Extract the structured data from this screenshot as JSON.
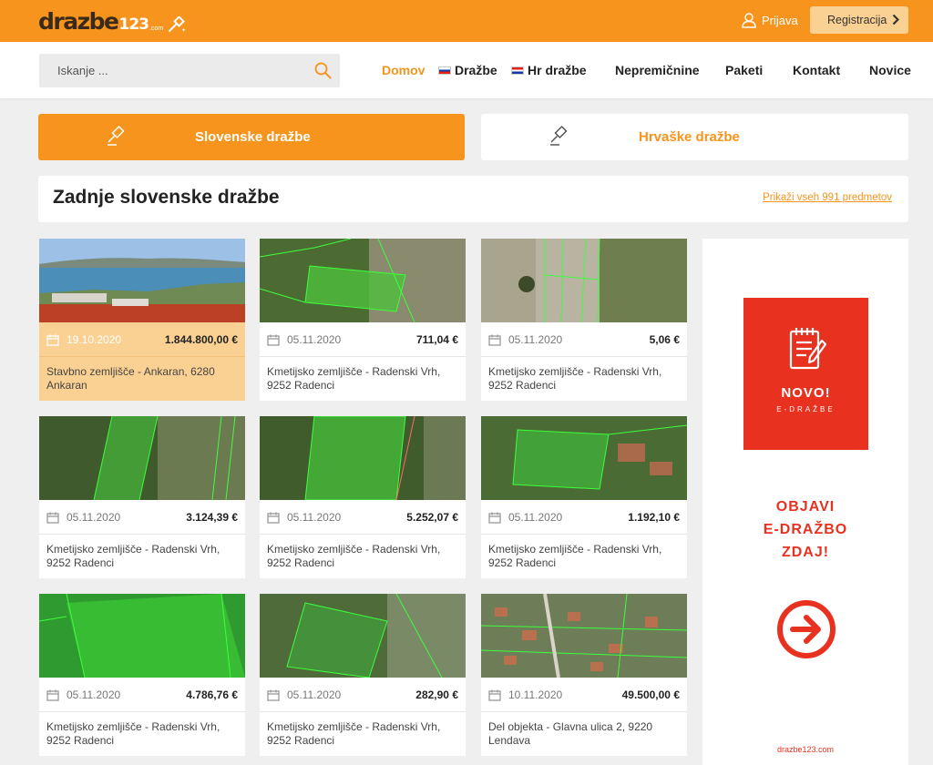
{
  "header": {
    "logo_text": "drazbe",
    "logo_num": "123",
    "logo_com": ".com",
    "login_label": "Prijava",
    "register_label": "Registracija"
  },
  "search": {
    "placeholder": "Iskanje ...",
    "value": ""
  },
  "nav": {
    "home": "Domov",
    "auctions": "Dražbe",
    "hr_auctions": "Hr dražbe",
    "real_estate": "Nepremičnine",
    "packages": "Paketi",
    "contact": "Kontakt",
    "news": "Novice"
  },
  "tabs": {
    "slovenian": "Slovenske dražbe",
    "croatian": "Hrvaške dražbe"
  },
  "section": {
    "title": "Zadnje slovenske dražbe",
    "link": "Prikaži vseh 991 predmetov"
  },
  "listings": [
    {
      "date": "19.10.2020",
      "price": "1.844.800,00 €",
      "title": "Stavbno zemljišče - Ankaran, 6280 Ankaran"
    },
    {
      "date": "05.11.2020",
      "price": "711,04 €",
      "title": "Kmetijsko zemljišče - Radenski Vrh, 9252 Radenci"
    },
    {
      "date": "05.11.2020",
      "price": "5,06 €",
      "title": "Kmetijsko zemljišče - Radenski Vrh, 9252 Radenci"
    },
    {
      "date": "05.11.2020",
      "price": "3.124,39 €",
      "title": "Kmetijsko zemljišče - Radenski Vrh, 9252 Radenci"
    },
    {
      "date": "05.11.2020",
      "price": "5.252,07 €",
      "title": "Kmetijsko zemljišče - Radenski Vrh, 9252 Radenci"
    },
    {
      "date": "05.11.2020",
      "price": "1.192,10 €",
      "title": "Kmetijsko zemljišče - Radenski Vrh, 9252 Radenci"
    },
    {
      "date": "05.11.2020",
      "price": "4.786,76 €",
      "title": "Kmetijsko zemljišče - Radenski Vrh, 9252 Radenci"
    },
    {
      "date": "05.11.2020",
      "price": "282,90 €",
      "title": "Kmetijsko zemljišče - Radenski Vrh, 9252 Radenci"
    },
    {
      "date": "10.11.2020",
      "price": "49.500,00 €",
      "title": "Del objekta - Glavna ulica 2, 9220 Lendava"
    }
  ],
  "ad": {
    "novo": "NOVO!",
    "edrazbe": "E-DRAŽBE",
    "cta_line1": "OBJAVI",
    "cta_line2": "E-DRAŽBO",
    "cta_line3": "ZDAJ!",
    "url": "drazbe123.com"
  },
  "colors": {
    "brand_orange": "#f7941d",
    "featured_bg": "#fbd193",
    "ad_red": "#e8311f"
  },
  "icons": {
    "user": "user-icon",
    "chevron": "chevron-right-icon",
    "search": "search-icon",
    "gavel": "gavel-icon",
    "calendar": "calendar-icon",
    "ad_note": "notepad-pencil-icon",
    "ad_arrow": "arrow-circle-right-icon"
  }
}
